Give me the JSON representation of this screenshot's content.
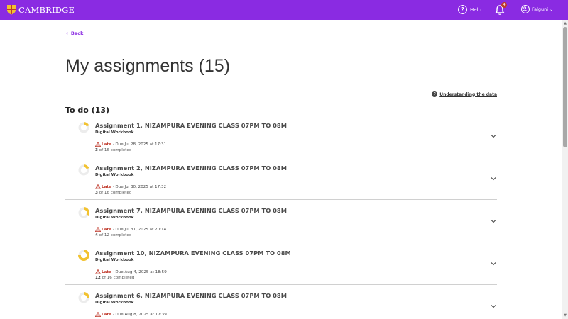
{
  "header": {
    "logo_text": "CAMBRIDGE",
    "help_label": "Help",
    "notification_count": "4",
    "user_name": "Falguni",
    "brand_color": "#8a2be2"
  },
  "back_label": "Back",
  "page_title": "My assignments (15)",
  "understanding_label": "Understanding the data",
  "section_heading": "To do (13)",
  "assignments": [
    {
      "title": "Assignment 1, NIZAMPURA EVENING CLASS 07PM TO 08M",
      "type": "Digital Workbook",
      "status": "Late",
      "due": "· Due Jul 28, 2025 at 17:31",
      "done": "3",
      "total_text": "of 16 completed",
      "fraction": 0.1875
    },
    {
      "title": "Assignment 2, NIZAMPURA EVENING CLASS 07PM TO 08M",
      "type": "Digital Workbook",
      "status": "Late",
      "due": "· Due Jul 30, 2025 at 17:32",
      "done": "3",
      "total_text": "of 16 completed",
      "fraction": 0.1875
    },
    {
      "title": "Assignment 7, NIZAMPURA EVENING CLASS 07PM TO 08M",
      "type": "Digital Workbook",
      "status": "Late",
      "due": "· Due Jul 31, 2025 at 20:14",
      "done": "4",
      "total_text": "of 12 completed",
      "fraction": 0.3333
    },
    {
      "title": "Assignment 10, NIZAMPURA EVENING CLASS 07PM TO 08M",
      "type": "Digital Workbook",
      "status": "Late",
      "due": "· Due Aug 4, 2025 at 18:59",
      "done": "12",
      "total_text": "of 16 completed",
      "fraction": 0.75
    },
    {
      "title": "Assignment 6, NIZAMPURA EVENING CLASS 07PM TO 08M",
      "type": "Digital Workbook",
      "status": "Late",
      "due": "· Due Aug 8, 2025 at 17:39",
      "done": "",
      "total_text": "",
      "fraction": 0.25
    }
  ]
}
